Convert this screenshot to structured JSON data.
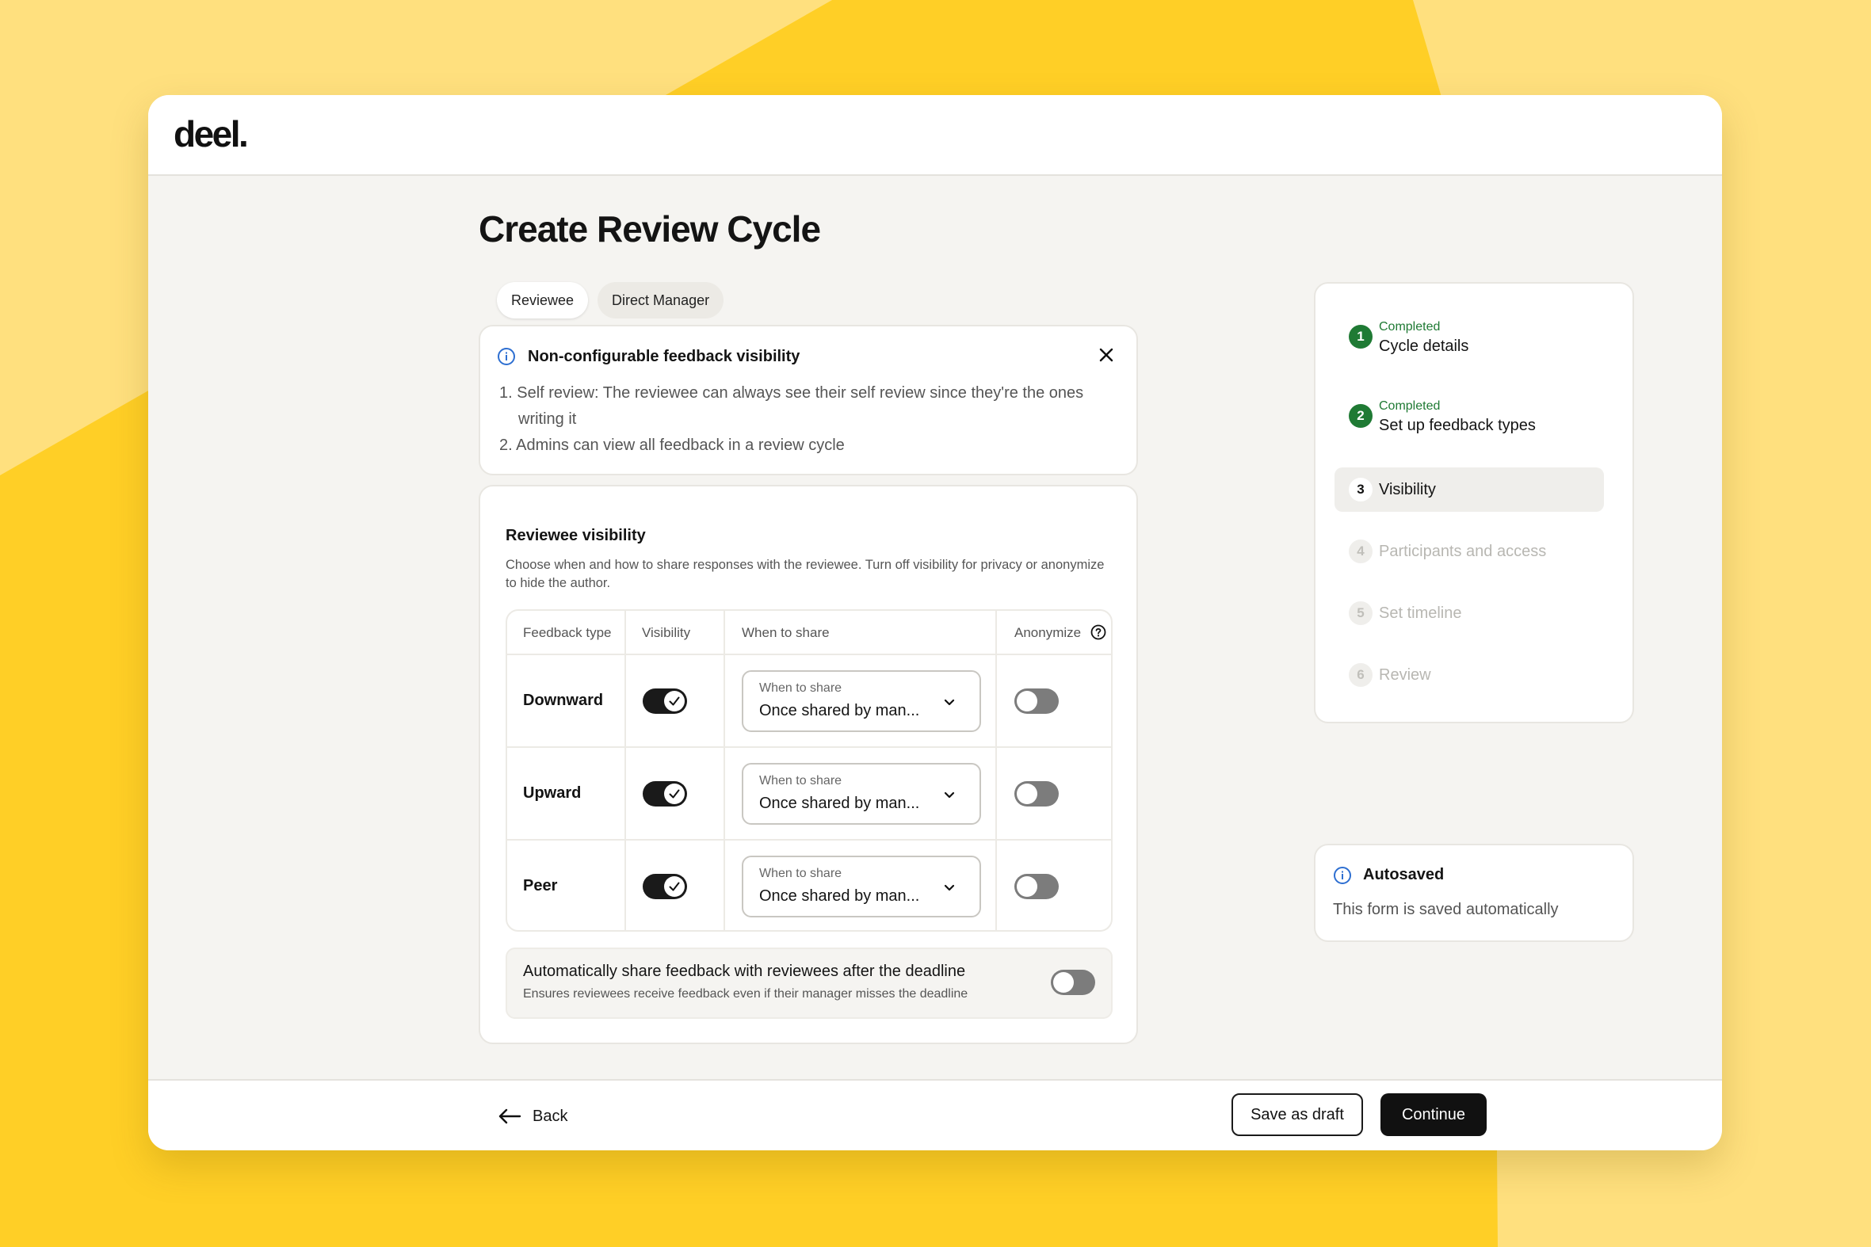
{
  "brand": {
    "logo": "deel",
    "logo_dot": "."
  },
  "page": {
    "title": "Create Review Cycle"
  },
  "tabs": [
    {
      "label": "Reviewee",
      "active": true
    },
    {
      "label": "Direct Manager",
      "active": false
    }
  ],
  "notice": {
    "title": "Non-configurable feedback visibility",
    "items": [
      "1. Self review: The reviewee can always see their self review since they're the ones writing it",
      "2. Admins can view all feedback in a review cycle"
    ]
  },
  "visibility": {
    "title": "Reviewee visibility",
    "description": "Choose when and how to share responses with the reviewee. Turn off visibility for privacy or anonymize to hide the author.",
    "columns": {
      "feedback_type": "Feedback type",
      "visibility": "Visibility",
      "when_to_share": "When to share",
      "anonymize": "Anonymize"
    },
    "rows": [
      {
        "type": "Downward",
        "visible": true,
        "select_label": "When to share",
        "select_value": "Once shared by man...",
        "anonymize": false
      },
      {
        "type": "Upward",
        "visible": true,
        "select_label": "When to share",
        "select_value": "Once shared by man...",
        "anonymize": false
      },
      {
        "type": "Peer",
        "visible": true,
        "select_label": "When to share",
        "select_value": "Once shared by man...",
        "anonymize": false
      }
    ],
    "auto_share": {
      "title": "Automatically share feedback with reviewees after the deadline",
      "description": "Ensures reviewees receive feedback even if their manager misses the deadline",
      "enabled": false
    }
  },
  "steps": [
    {
      "number": "1",
      "status": "Completed",
      "name": "Cycle details",
      "state": "done"
    },
    {
      "number": "2",
      "status": "Completed",
      "name": "Set up feedback types",
      "state": "done"
    },
    {
      "number": "3",
      "status": "",
      "name": "Visibility",
      "state": "current"
    },
    {
      "number": "4",
      "status": "",
      "name": "Participants and access",
      "state": "todo"
    },
    {
      "number": "5",
      "status": "",
      "name": "Set timeline",
      "state": "todo"
    },
    {
      "number": "6",
      "status": "",
      "name": "Review",
      "state": "todo"
    }
  ],
  "autosave": {
    "title": "Autosaved",
    "description": "This form is saved automatically"
  },
  "footer": {
    "back": "Back",
    "save_draft": "Save as draft",
    "continue": "Continue"
  },
  "colors": {
    "background": "#FFE07E",
    "accent": "#FFCF26",
    "success": "#1F7A34",
    "primary": "#111111"
  },
  "icons": {
    "info": "info-icon",
    "close": "close-icon",
    "help": "help-icon",
    "chevron": "chevron-down-icon",
    "check": "check-icon",
    "back": "arrow-left-icon"
  }
}
